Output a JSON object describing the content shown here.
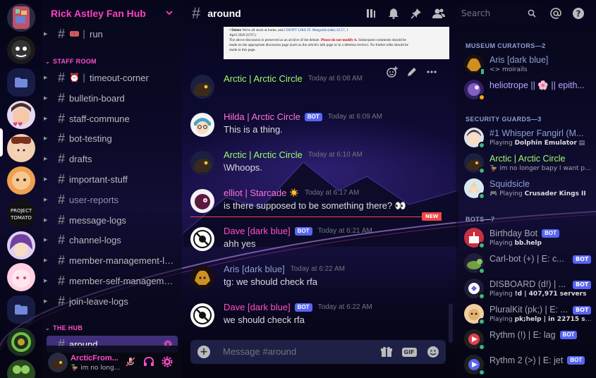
{
  "server": {
    "name": "Rick Astley Fan Hub"
  },
  "server_rail": {
    "icons": [
      "server-mosaic",
      "server-shadow-mask",
      "folder",
      "server-girl-hearts",
      "server-hat-girl",
      "server-orange-face",
      "server-project-tomato",
      "server-purple-hair",
      "server-pink-girl",
      "folder",
      "server-green-ring",
      "server-green-goggles"
    ]
  },
  "channels": {
    "top": [
      {
        "name": "run",
        "emoji": "🎟️"
      }
    ],
    "staff_category": "STAFF ROOM",
    "staff": [
      {
        "name": "timeout-corner",
        "emoji": "⏰"
      },
      {
        "name": "bulletin-board"
      },
      {
        "name": "staff-commune"
      },
      {
        "name": "bot-testing"
      },
      {
        "name": "drafts"
      },
      {
        "name": "important-stuff"
      },
      {
        "name": "user-reports"
      },
      {
        "name": "message-logs"
      },
      {
        "name": "channel-logs"
      },
      {
        "name": "member-management-logs"
      },
      {
        "name": "member-self-manageme..."
      },
      {
        "name": "join-leave-logs"
      }
    ],
    "hub_category": "THE HUB",
    "hub": [
      {
        "name": "around"
      }
    ]
  },
  "user_panel": {
    "name": "ArcticFrom...",
    "status": "im no long..."
  },
  "chat_header": {
    "channel": "around",
    "search_placeholder": "Search"
  },
  "embed_text": {
    "line1a": "• Delete ",
    "line1b": "We're all stuck at home, and ",
    "line1c": "I DON'T LIKE IT. Margolob (talk) 22:57, 1",
    "line2": "April 2020 (UTC)",
    "line3a": "The above discussion is preserved as an archive of the debate. ",
    "line3b": "Please do not modify it.",
    "line3c": " Subsequent comments should be",
    "line4": "made on the appropriate discussion page (such as the article's talk page or in a deletion review). No further edits should be",
    "line5": "made to this page."
  },
  "messages": [
    {
      "author": "Arctic | Arctic Circle",
      "color": "#9cff6b",
      "bot": false,
      "time": "Today at 6:08 AM",
      "text": "",
      "avatar": "arctic"
    },
    {
      "author": "Hilda | Arctic Circle",
      "color": "#ff73d8",
      "bot": true,
      "time": "Today at 6:09 AM",
      "text": "This is a thing.",
      "avatar": "hilda"
    },
    {
      "author": "Arctic | Arctic Circle",
      "color": "#9cff6b",
      "bot": false,
      "time": "Today at 6:10 AM",
      "text": "\\Whoops.",
      "avatar": "arctic"
    },
    {
      "author": "elliot | Starcade",
      "color": "#ff73d8",
      "bot": false,
      "time": "Today at 6:17 AM",
      "text": "is there supposed to be something there? 👀",
      "avatar": "elliot",
      "emoji": "☀️"
    },
    {
      "author": "Dave [dark blue]",
      "color": "#ff4fc8",
      "bot": true,
      "time": "Today at 6:21 AM",
      "text": "ahh yes",
      "avatar": "dave"
    },
    {
      "author": "Aris [dark blue]",
      "color": "#8ea0d0",
      "bot": false,
      "time": "Today at 6:22 AM",
      "text": "tg: we should check rfa",
      "avatar": "aris"
    },
    {
      "author": "Dave [dark blue]",
      "color": "#ff4fc8",
      "bot": true,
      "time": "Today at 6:22 AM",
      "text": "we should check rfa",
      "avatar": "dave"
    }
  ],
  "new_badge": "NEW",
  "bot_label": "BOT",
  "composer": {
    "placeholder": "Message #around",
    "gif_label": "GIF"
  },
  "members": {
    "groups": [
      {
        "title": "MUSEUM CURATORS—2",
        "items": [
          {
            "name": "Aris [dark blue]",
            "sub": "<> moirails",
            "color": "#8ea0d0"
          },
          {
            "name": "heliotrope || 🌸 || epith...",
            "sub": "",
            "color": "#b9a7ff"
          }
        ]
      },
      {
        "title": "SECURITY GUARDS—3",
        "items": [
          {
            "name": "#1 Whisper Fangirl (M...",
            "sub_prefix": "Playing ",
            "sub_bold": "Dolphin Emulator",
            "color": "#8ea0d0"
          },
          {
            "name": "Arctic | Arctic Circle",
            "sub": "im no longer bapy I want p...",
            "color": "#9cff6b"
          },
          {
            "name": "Squidsicle",
            "sub_prefix": "Playing ",
            "sub_bold": "Crusader Kings II",
            "color": "#8ea0d0"
          }
        ]
      },
      {
        "title": "BOTS—7",
        "items": [
          {
            "name": "Birthday Bot",
            "sub_prefix": "Playing ",
            "sub_bold": "bb.help",
            "color": "#a5a7b5",
            "bot": true
          },
          {
            "name": "Carl-bot (+) | E: c...",
            "sub": "",
            "color": "#a5a7b5",
            "bot": true
          },
          {
            "name": "DISBOARD (d!) | ...",
            "sub_prefix": "Playing ",
            "sub_bold": "!d | 407,971 servers",
            "color": "#a5a7b5",
            "bot": true
          },
          {
            "name": "PluralKit (pk;) | E: ...",
            "sub_prefix": "Playing ",
            "sub_bold": "pk;help | in 22715 serv...",
            "color": "#a5a7b5",
            "bot": true
          },
          {
            "name": "Rythm (!) | E: lag",
            "sub": "",
            "color": "#a5a7b5",
            "bot": true
          },
          {
            "name": "Rythm 2 (>) | E: jet",
            "sub": "",
            "color": "#a5a7b5",
            "bot": true
          }
        ]
      }
    ]
  },
  "colors": {
    "accent_pink": "#ff3fc0",
    "online": "#43b581",
    "idle": "#faa61a",
    "bot_blue": "#5865f2",
    "new_red": "#f04747"
  }
}
